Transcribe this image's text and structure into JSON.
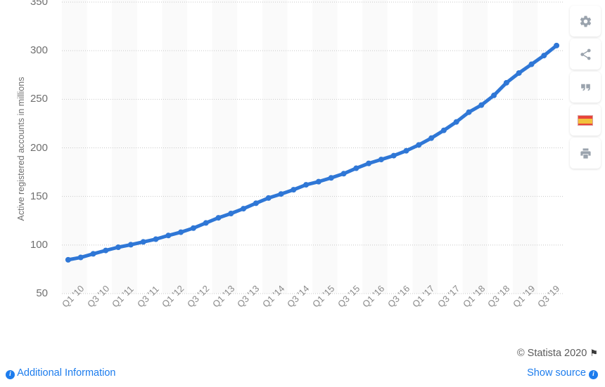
{
  "chart_data": {
    "type": "line",
    "title": "",
    "xlabel": "",
    "ylabel": "Active registered accounts in millions",
    "ylim": [
      50,
      350
    ],
    "yticks": [
      50,
      100,
      150,
      200,
      250,
      300,
      350
    ],
    "grid": true,
    "legend": "none",
    "line_color": "#2f77d6",
    "marker": "circle",
    "x": [
      "Q1 '10",
      "Q2 '10",
      "Q3 '10",
      "Q4 '10",
      "Q1 '11",
      "Q2 '11",
      "Q3 '11",
      "Q4 '11",
      "Q1 '12",
      "Q2 '12",
      "Q3 '12",
      "Q4 '12",
      "Q1 '13",
      "Q2 '13",
      "Q3 '13",
      "Q4 '13",
      "Q1 '14",
      "Q2 '14",
      "Q3 '14",
      "Q4 '14",
      "Q1 '15",
      "Q2 '15",
      "Q3 '15",
      "Q4 '15",
      "Q1 '16",
      "Q2 '16",
      "Q3 '16",
      "Q4 '16",
      "Q1 '17",
      "Q2 '17",
      "Q3 '17",
      "Q4 '17",
      "Q1 '18",
      "Q2 '18",
      "Q3 '18",
      "Q4 '18",
      "Q1 '19",
      "Q2 '19",
      "Q3 '19",
      "Q4 '19"
    ],
    "xticklabels": [
      "Q1 '10",
      "Q3 '10",
      "Q1 '11",
      "Q3 '11",
      "Q1 '12",
      "Q3 '12",
      "Q1 '13",
      "Q3 '13",
      "Q1 '14",
      "Q3 '14",
      "Q1 '15",
      "Q3 '15",
      "Q1 '16",
      "Q3 '16",
      "Q1 '17",
      "Q3 '17",
      "Q1 '18",
      "Q3 '18",
      "Q1 '19",
      "Q3 '19"
    ],
    "values": [
      84.8,
      87.2,
      90.9,
      94.4,
      97.7,
      100.3,
      103.2,
      106.0,
      109.8,
      113.2,
      117.4,
      122.7,
      128.0,
      132.4,
      137.4,
      143.0,
      148.4,
      152.5,
      156.9,
      162.0,
      165.2,
      169.1,
      173.4,
      179.0,
      184.0,
      188.0,
      192.0,
      197.0,
      203.0,
      210.0,
      218.0,
      226.7,
      236.7,
      244.0,
      254.0,
      267.0,
      277.0,
      286.0,
      295.0,
      305.3
    ]
  },
  "axis": {
    "ylabel": "Active registered accounts in millions"
  },
  "toolbar": {
    "items": [
      {
        "name": "settings-icon",
        "label": "Settings"
      },
      {
        "name": "share-icon",
        "label": "Share"
      },
      {
        "name": "citation-icon",
        "label": "Cite"
      },
      {
        "name": "language-flag-icon",
        "label": "Spanish"
      },
      {
        "name": "print-icon",
        "label": "Print"
      }
    ]
  },
  "footer": {
    "additional_information": "Additional Information",
    "copyright": "© Statista 2020",
    "show_source": "Show source",
    "info_glyph": "i",
    "flag_glyph": "⚑"
  }
}
